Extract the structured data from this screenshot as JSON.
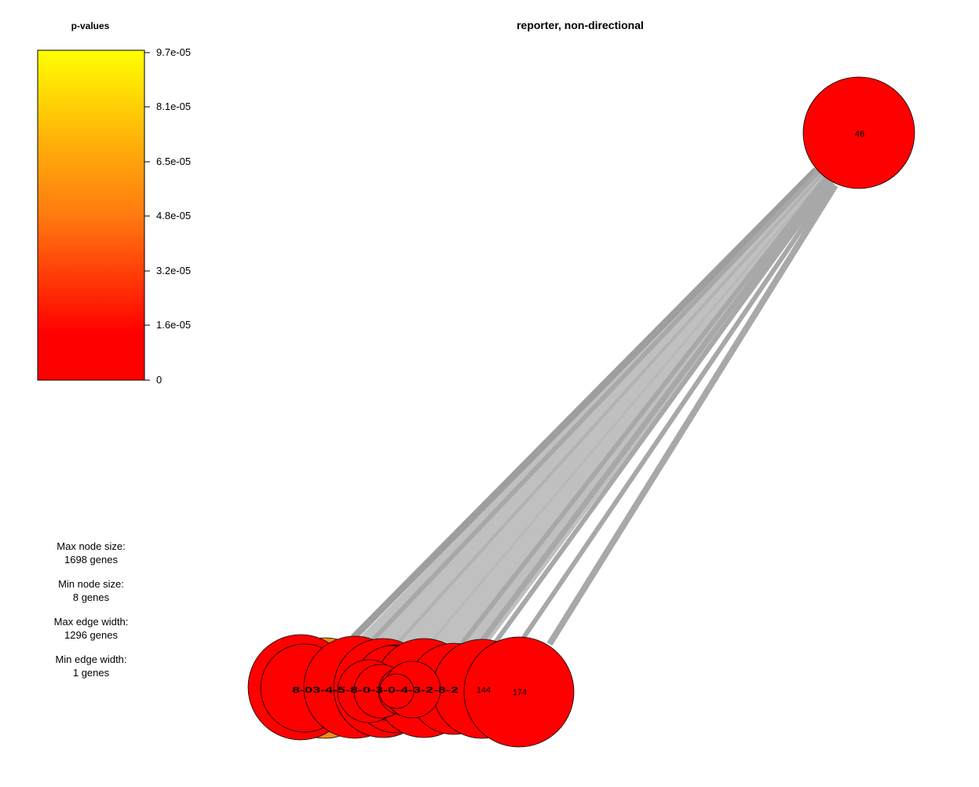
{
  "plot_title": "reporter, non-directional",
  "colorbar": {
    "title": "p-values",
    "ticks": [
      "9.7e-05",
      "8.1e-05",
      "6.5e-05",
      "4.8e-05",
      "3.2e-05",
      "1.6e-05",
      "0"
    ],
    "colors": {
      "low": "#ff0000",
      "mid": "#ff8c00",
      "high": "#ffff00"
    }
  },
  "size_legend": {
    "max_node_label": "Max node size:",
    "max_node_value": "1698 genes",
    "min_node_label": "Min node size:",
    "min_node_value": "8 genes",
    "max_edge_label": "Max edge width:",
    "max_edge_value": "1296 genes",
    "min_edge_label": "Min edge width:",
    "min_edge_value": "1 genes"
  },
  "nodes": {
    "hub": {
      "label": "46",
      "color": "#ff0000"
    },
    "large_right": {
      "label": "174",
      "color": "#ff0000"
    },
    "mid_right": {
      "label": "144",
      "color": "#ff0000"
    },
    "clustered": {
      "label": "8-03-4-5-8-0-3-0-4-3-2-8-2",
      "color": "#ff0000"
    },
    "orange_node_color": "#f08a1a"
  },
  "edge_color": "#a8a8a8"
}
